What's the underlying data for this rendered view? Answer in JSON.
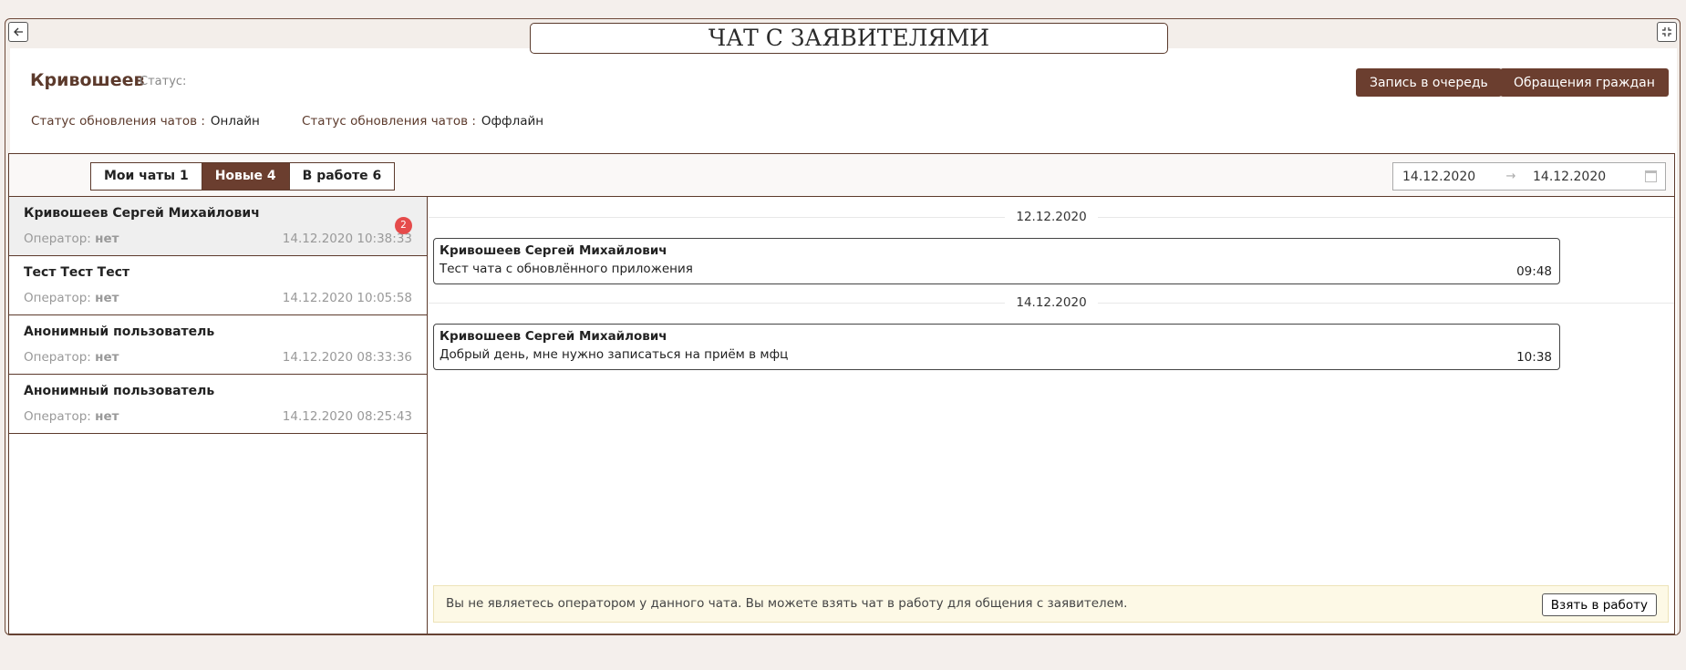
{
  "window": {
    "title": "ЧАТ С ЗАЯВИТЕЛЯМИ",
    "back_icon": "arrow-left-icon",
    "fullscreen_icon": "collapse-icon"
  },
  "header": {
    "user_name": "Кривошеев",
    "status_label": "Статус:",
    "update_status_1": {
      "label": "Статус обновления чатов :",
      "value": "Онлайн"
    },
    "update_status_2": {
      "label": "Статус обновления чатов :",
      "value": "Оффлайн"
    },
    "queue_button": "Запись в очередь",
    "appeals_button": "Обращения граждан"
  },
  "tabs": [
    {
      "label": "Мои чаты 1",
      "active": false
    },
    {
      "label": "Новые 4",
      "active": true
    },
    {
      "label": "В работе 6",
      "active": false
    }
  ],
  "date_range": {
    "from": "14.12.2020",
    "to": "14.12.2020",
    "arrow": "→"
  },
  "chats": [
    {
      "name": "Кривошеев Сергей Михайлович",
      "operator_label": "Оператор:",
      "operator": "нет",
      "time": "14.12.2020 10:38:33",
      "badge": "2"
    },
    {
      "name": "Тест Тест Тест",
      "operator_label": "Оператор:",
      "operator": "нет",
      "time": "14.12.2020 10:05:58"
    },
    {
      "name": "Анонимный пользователь",
      "operator_label": "Оператор:",
      "operator": "нет",
      "time": "14.12.2020 08:33:36"
    },
    {
      "name": "Анонимный пользователь",
      "operator_label": "Оператор:",
      "operator": "нет",
      "time": "14.12.2020 08:25:43"
    }
  ],
  "messages": [
    {
      "date": "12.12.2020",
      "author": "Кривошеев Сергей Михайлович",
      "text": "Тест чата с обновлённого приложения",
      "time": "09:48"
    },
    {
      "date": "14.12.2020",
      "author": "Кривошеев Сергей Михайлович",
      "text": "Добрый день, мне нужно записаться на приём в мфц",
      "time": "10:38"
    }
  ],
  "notice": {
    "text": "Вы не являетесь оператором у данного чата. Вы можете взять чат в работу для общения с заявителем.",
    "button": "Взять в работу"
  },
  "colors": {
    "accent": "#6b3e2f",
    "badge": "#e54b4b",
    "notice_bg": "#fdf9e6"
  }
}
